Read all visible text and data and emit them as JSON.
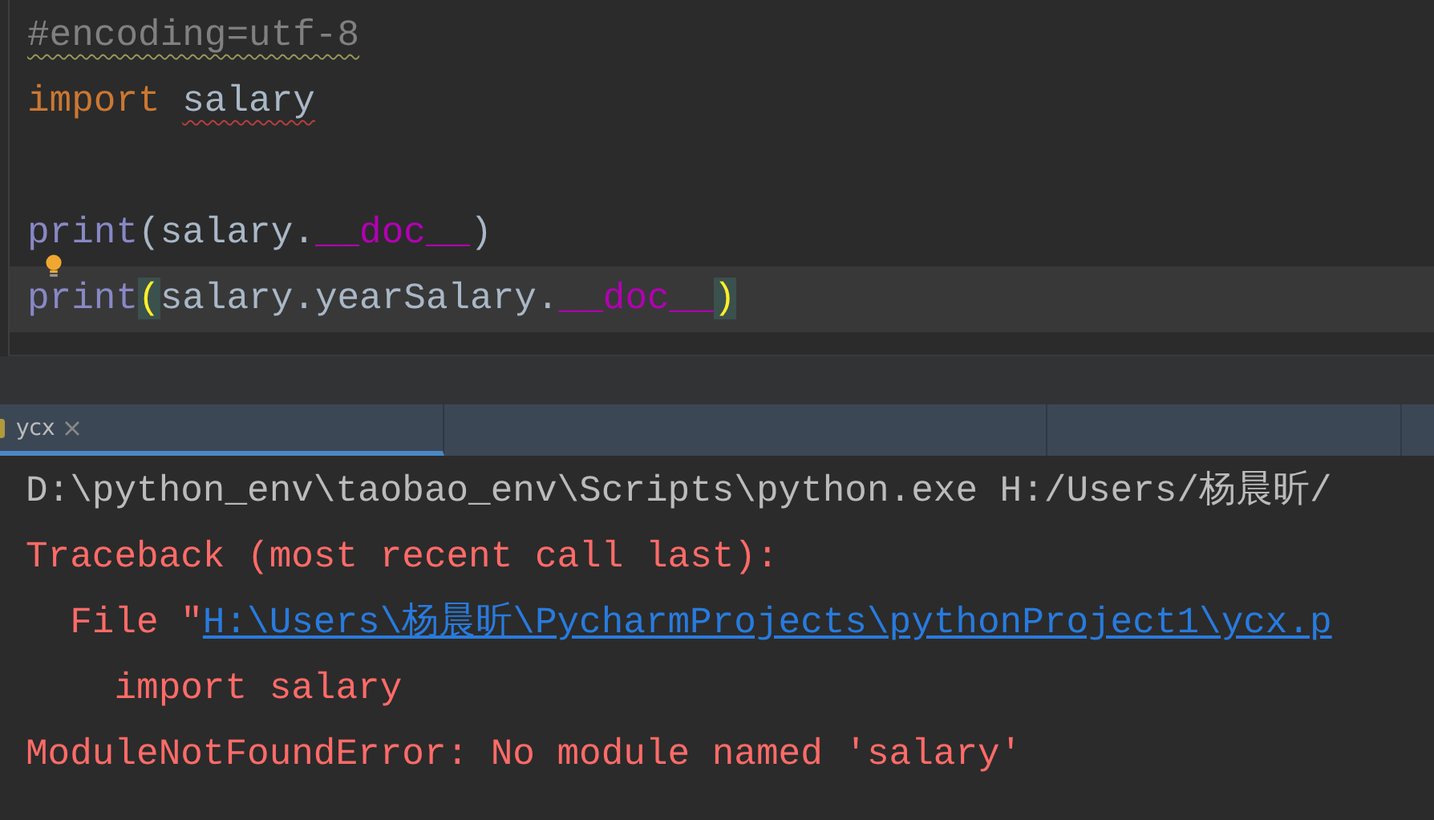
{
  "editor": {
    "lines": [
      {
        "current": false,
        "tokens": [
          {
            "text": "#encoding=utf-8",
            "kind": "comment",
            "warning": true,
            "error": false
          }
        ]
      },
      {
        "current": false,
        "tokens": [
          {
            "text": "import ",
            "kind": "keyword",
            "warning": false,
            "error": false
          },
          {
            "text": "salary",
            "kind": "plain",
            "warning": false,
            "error": true
          }
        ]
      },
      {
        "current": false
      },
      {
        "current": false,
        "bulb": true,
        "tokens": [
          {
            "text": "print",
            "kind": "builtin",
            "warning": false,
            "error": false
          },
          {
            "text": "(salary.",
            "kind": "plain",
            "warning": false,
            "error": false
          },
          {
            "text": "__doc__",
            "kind": "dunder",
            "warning": false,
            "error": false
          },
          {
            "text": ")",
            "kind": "plain",
            "warning": false,
            "error": false
          }
        ]
      },
      {
        "current": true,
        "tokens": [
          {
            "text": "print",
            "kind": "builtin",
            "warning": false,
            "error": false
          },
          {
            "text": "(",
            "kind": "bracket",
            "warning": false,
            "error": false
          },
          {
            "text": "salary.yearSalary.",
            "kind": "plain",
            "warning": false,
            "error": false
          },
          {
            "text": "__doc__",
            "kind": "dunder",
            "warning": false,
            "error": false
          },
          {
            "text": ")",
            "kind": "bracket",
            "warning": false,
            "error": false
          }
        ]
      }
    ]
  },
  "run_tabs": [
    {
      "label": "ycx",
      "selected": true
    }
  ],
  "console": {
    "lines": [
      {
        "segments": [
          {
            "text": "D:\\python_env\\taobao_env\\Scripts\\python.exe H:/Users/杨晨昕/",
            "kind": "plain"
          }
        ]
      },
      {
        "segments": [
          {
            "text": "Traceback (most recent call last):",
            "kind": "error"
          }
        ]
      },
      {
        "segments": [
          {
            "text": "  File \"",
            "kind": "error"
          },
          {
            "text": "H:\\Users\\杨晨昕\\PycharmProjects\\pythonProject1\\ycx.p",
            "kind": "link"
          }
        ]
      },
      {
        "segments": [
          {
            "text": "    import salary",
            "kind": "error"
          }
        ]
      },
      {
        "segments": [
          {
            "text": "ModuleNotFoundError: No module named 'salary'",
            "kind": "error"
          }
        ]
      }
    ]
  }
}
